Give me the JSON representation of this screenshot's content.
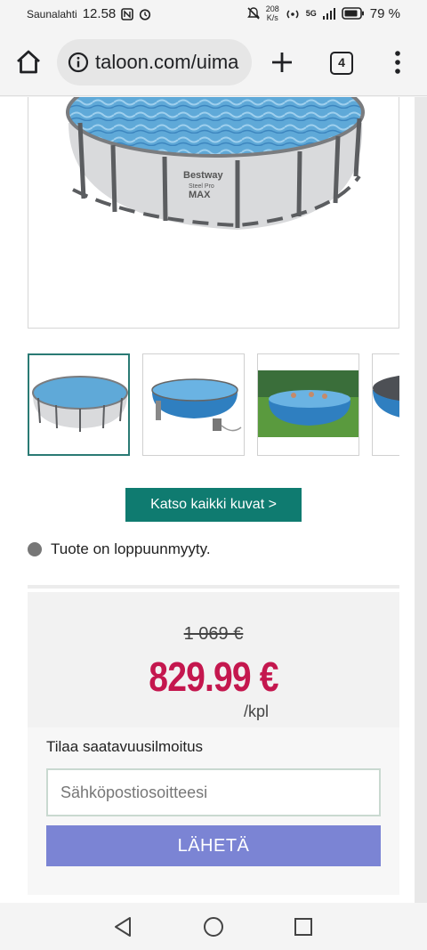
{
  "status_bar": {
    "carrier": "Saunalahti",
    "time": "12.58",
    "net_speed_value": "208",
    "net_speed_unit": "K/s",
    "network": "5G",
    "battery": "79 %"
  },
  "browser": {
    "url": "taloon.com/uima",
    "tab_count": "4"
  },
  "product": {
    "main_image": {
      "brand_text": "Bestway",
      "model_text": "Steel Pro",
      "model_suffix": "MAX"
    },
    "thumbnails": [
      {
        "name": "pool-front",
        "active": true
      },
      {
        "name": "pool-with-ladder-filter",
        "active": false
      },
      {
        "name": "pool-in-garden",
        "active": false
      },
      {
        "name": "pool-cover",
        "active": false
      }
    ],
    "all_images_button": "Katso kaikki kuvat >",
    "stock_status": "Tuote on loppuunmyyty.",
    "old_price": "1 069 €",
    "price": "829.99 €",
    "unit": "/kpl"
  },
  "notify": {
    "title": "Tilaa saatavuusilmoitus",
    "email_placeholder": "Sähköpostiosoitteesi",
    "submit_label": "LÄHETÄ"
  },
  "colors": {
    "accent_teal": "#0f7b70",
    "price_red": "#c4174e",
    "submit_purple": "#7b84d4",
    "pool_blue": "#3f8fc4"
  }
}
